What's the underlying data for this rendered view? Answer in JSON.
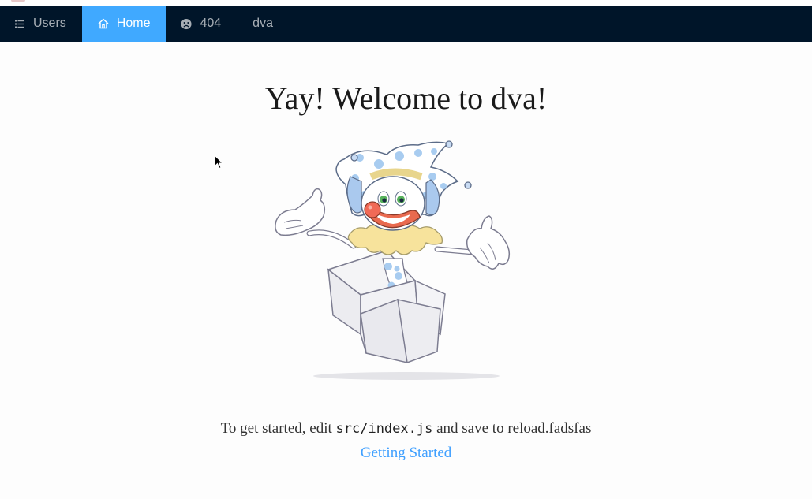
{
  "nav": {
    "items": [
      {
        "label": "Users",
        "icon": "bars-icon",
        "active": false
      },
      {
        "label": "Home",
        "icon": "home-icon",
        "active": true
      },
      {
        "label": "404",
        "icon": "frown-icon",
        "active": false
      },
      {
        "label": "dva",
        "icon": "",
        "active": false
      }
    ],
    "bg_color": "#001529",
    "active_color": "#40a9ff"
  },
  "main": {
    "title": "Yay! Welcome to dva!",
    "illustration": "jack-in-the-box clown",
    "started_prefix": "To get started, edit ",
    "started_code": "src/index.js",
    "started_suffix": " and save to reload.fadsfas",
    "link_label": "Getting Started"
  },
  "colors": {
    "link": "#40a0ff",
    "title": "#1a1a1a"
  }
}
